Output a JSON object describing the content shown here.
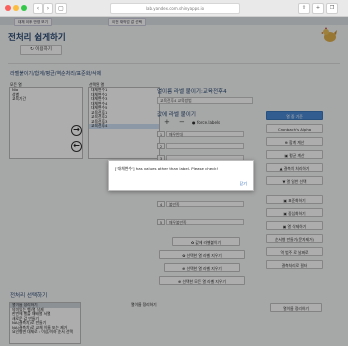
{
  "browser": {
    "url": "lab.yandex.com.shinyapps.io",
    "nav_back": "‹",
    "nav_forward": "›",
    "sidebar": "▢"
  },
  "tabs": [
    "대체 이후 반영 보기",
    "이전 재작업 값 선택"
  ],
  "page": {
    "title": "전처리 쉽게하기",
    "back_button": "↻ 이용하기"
  },
  "left": {
    "section_title": "라벨붙이기/합계/평균/역순처리/표준화/삭제",
    "all_label": "모든 열",
    "selected_label": "선택된 열",
    "all_items": [
      "Nio",
      "성별",
      "교육기간"
    ],
    "selected_items": [
      "대체변수1",
      "대체변수2",
      "대체변수3",
      "대체변수4",
      "대체변수5",
      "교육전후1",
      "교육전후2",
      "교육전후3",
      "교육전후4"
    ],
    "arrow_right": "→",
    "arrow_left": "←"
  },
  "middle": {
    "label_heading": "열이름 라벨 붙이기:교육전후4",
    "label_input": "교육전후4 교육방법",
    "value_heading": "값에 라벨 붙이기",
    "plus": "+",
    "minus": "−",
    "force_label": "force.labels",
    "rows": [
      {
        "num": "1",
        "text": "매우반대"
      },
      {
        "num": "2",
        "text": ""
      },
      {
        "num": "3",
        "text": ""
      },
      {
        "num": "4",
        "text": "불만족"
      },
      {
        "num": "5",
        "text": "매우불만족"
      }
    ],
    "buttons": [
      "✿ 값에 라벨붙이기",
      "✿ 선택한 열 라벨 지우기",
      "⊕ 선택한 열 라벨 지우기",
      "⊕ 선택한 모든 열 라벨 지우기"
    ]
  },
  "sidebar": {
    "buttons": [
      "열 중 기준",
      "Cronbach's Alpha",
      "⊕ 합계 계산",
      "▣ 평균 계산",
      "▲ 결측치 처리하기",
      "▼ 열 일반 선택",
      "▣ 표준화하기",
      "▣ 중심화하기",
      "▣ 열 삭제하기",
      "순서형 만들기(문자제거)",
      "역 범주 로 날짜로",
      "결측처리로 필터"
    ]
  },
  "modal": {
    "message": "['대체변수'] has values other than label. Please check!",
    "ok": "닫기"
  },
  "bottom": {
    "section_title": "전처리 선택하기",
    "list_items": [
      "열이름 정리하기",
      "의미있는 행/열 삭제",
      "한번에 행을 재배열 서열",
      "새로운 값 만들기",
      "NA(결측치)로 만들기",
      "NA(결측치)로 교체 이름 또는 제거",
      "요인형변 대체로 : 이상/이하 순서 선택"
    ],
    "mid_label": "열이름 정리하기",
    "right_button": "열이름 정리하기"
  }
}
